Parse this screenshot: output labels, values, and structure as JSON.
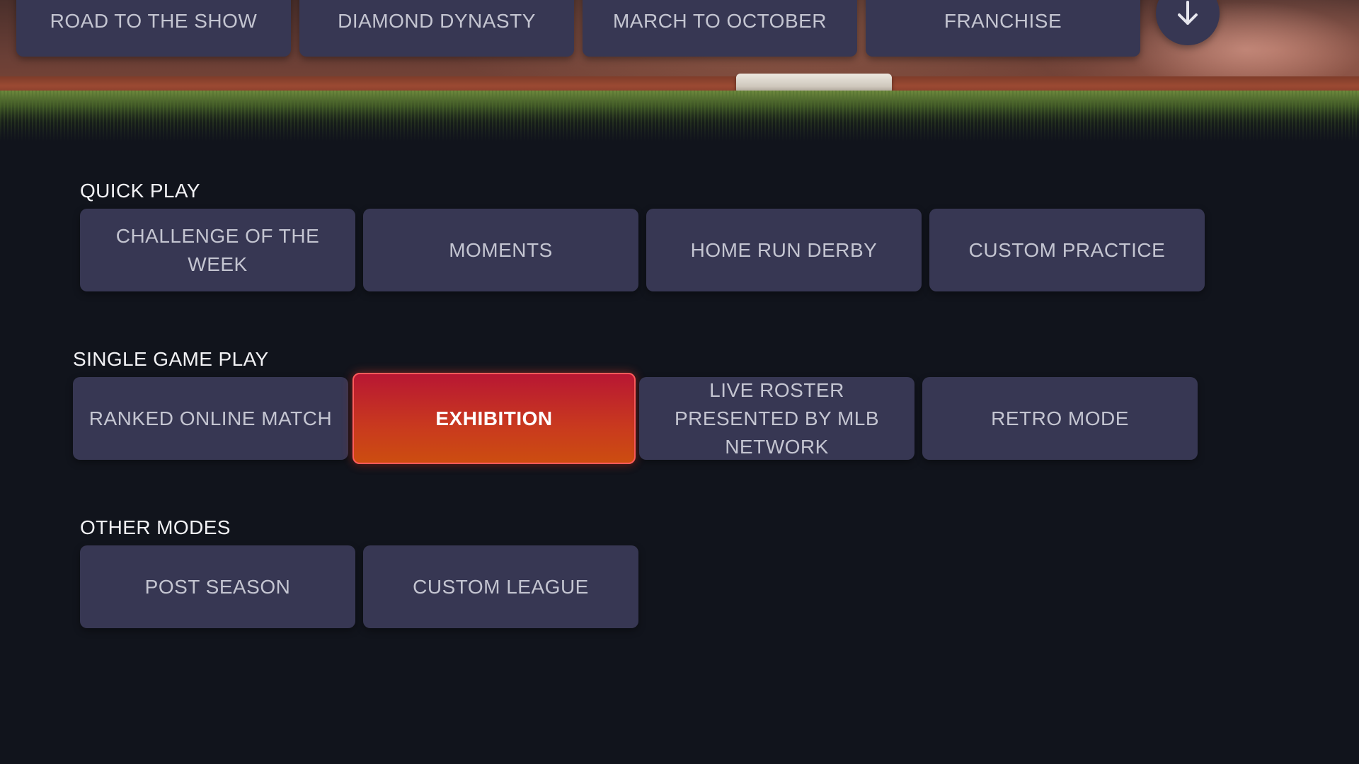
{
  "top_modes": [
    {
      "label": "ROAD TO THE SHOW"
    },
    {
      "label": "DIAMOND DYNASTY"
    },
    {
      "label": "MARCH TO OCTOBER"
    },
    {
      "label": "FRANCHISE"
    }
  ],
  "scroll_icon": "arrow-down-icon",
  "sections": {
    "quick_play": {
      "title": "QUICK PLAY",
      "items": [
        {
          "label": "CHALLENGE OF THE WEEK"
        },
        {
          "label": "MOMENTS"
        },
        {
          "label": "HOME RUN DERBY"
        },
        {
          "label": "CUSTOM PRACTICE"
        }
      ]
    },
    "single_game_play": {
      "title": "SINGLE GAME PLAY",
      "items": [
        {
          "label": "RANKED ONLINE MATCH"
        },
        {
          "label": "EXHIBITION",
          "selected": true
        },
        {
          "label": "LIVE ROSTER PRESENTED BY MLB NETWORK"
        },
        {
          "label": "RETRO MODE"
        }
      ]
    },
    "other_modes": {
      "title": "OTHER MODES",
      "items": [
        {
          "label": "POST SEASON"
        },
        {
          "label": "CUSTOM LEAGUE"
        }
      ]
    }
  },
  "colors": {
    "background": "#11141c",
    "tile": "#373753",
    "tile_text": "#c4c5d1",
    "selected_start": "#b81733",
    "selected_end": "#cc4d10",
    "selected_border": "#ff5b5b"
  }
}
